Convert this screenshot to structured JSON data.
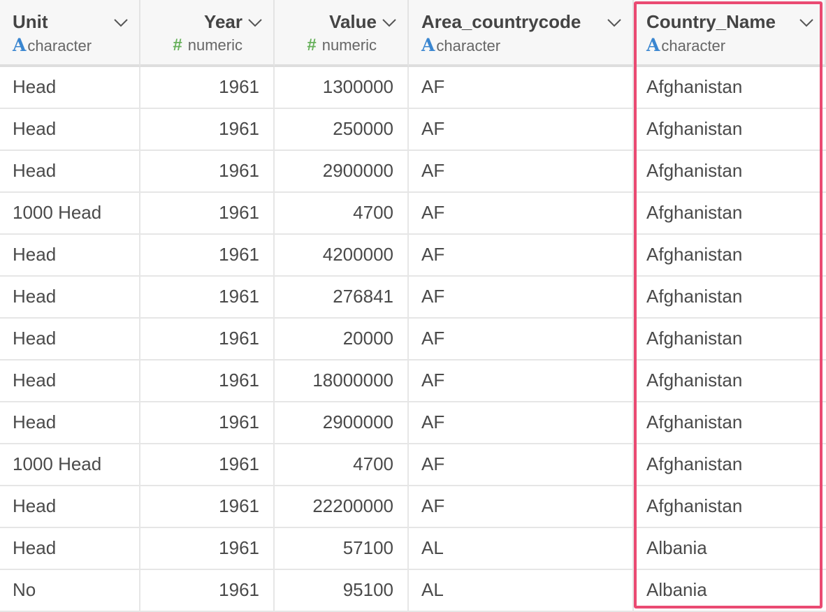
{
  "columns": [
    {
      "name": "Unit",
      "type": "character",
      "type_icon": "A",
      "type_icon_name": "character-type-icon"
    },
    {
      "name": "Year",
      "type": "numeric",
      "type_icon": "#",
      "type_icon_name": "numeric-type-icon"
    },
    {
      "name": "Value",
      "type": "numeric",
      "type_icon": "#",
      "type_icon_name": "numeric-type-icon"
    },
    {
      "name": "Area_countrycode",
      "type": "character",
      "type_icon": "A",
      "type_icon_name": "character-type-icon"
    },
    {
      "name": "Country_Name",
      "type": "character",
      "type_icon": "A",
      "type_icon_name": "character-type-icon"
    }
  ],
  "rows": [
    [
      "Head",
      "1961",
      "1300000",
      "AF",
      "Afghanistan"
    ],
    [
      "Head",
      "1961",
      "250000",
      "AF",
      "Afghanistan"
    ],
    [
      "Head",
      "1961",
      "2900000",
      "AF",
      "Afghanistan"
    ],
    [
      "1000 Head",
      "1961",
      "4700",
      "AF",
      "Afghanistan"
    ],
    [
      "Head",
      "1961",
      "4200000",
      "AF",
      "Afghanistan"
    ],
    [
      "Head",
      "1961",
      "276841",
      "AF",
      "Afghanistan"
    ],
    [
      "Head",
      "1961",
      "20000",
      "AF",
      "Afghanistan"
    ],
    [
      "Head",
      "1961",
      "18000000",
      "AF",
      "Afghanistan"
    ],
    [
      "Head",
      "1961",
      "2900000",
      "AF",
      "Afghanistan"
    ],
    [
      "1000 Head",
      "1961",
      "4700",
      "AF",
      "Afghanistan"
    ],
    [
      "Head",
      "1961",
      "22200000",
      "AF",
      "Afghanistan"
    ],
    [
      "Head",
      "1961",
      "57100",
      "AL",
      "Albania"
    ],
    [
      "No",
      "1961",
      "95100",
      "AL",
      "Albania"
    ]
  ],
  "highlighted_column": "Country_Name",
  "colors": {
    "highlight_border": "#ea4a72",
    "character_icon": "#3a86d0",
    "numeric_icon": "#66b05a",
    "header_bg": "#f7f7f7"
  }
}
